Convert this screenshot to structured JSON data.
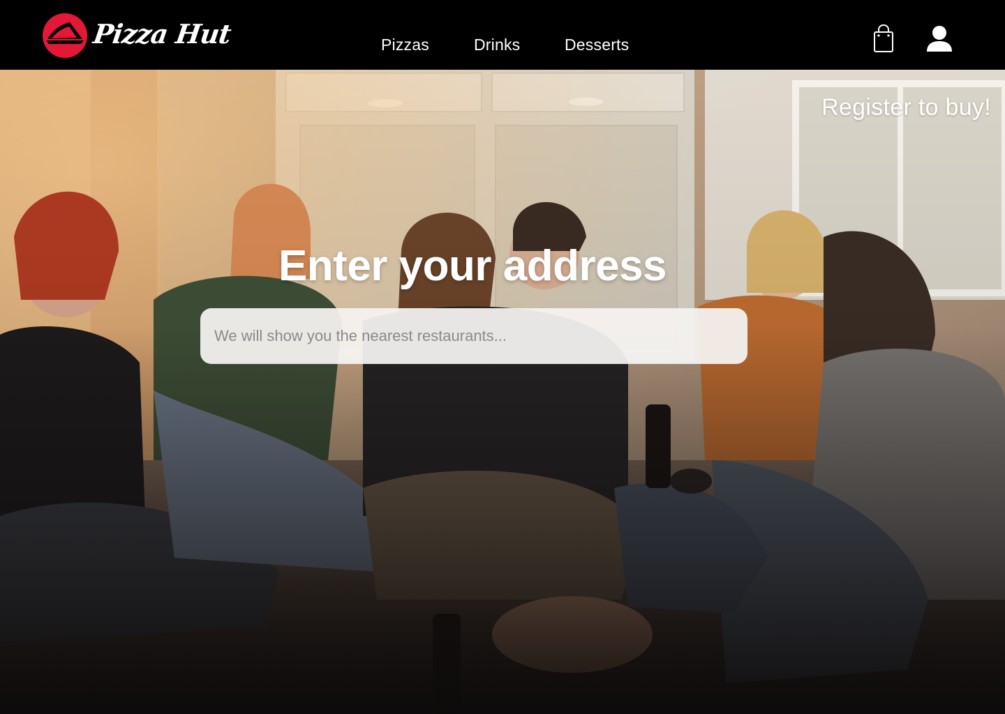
{
  "header": {
    "brand": "Pizza Hut",
    "nav": {
      "pizzas": "Pizzas",
      "drinks": "Drinks",
      "desserts": "Desserts"
    },
    "icons": {
      "cart": "shopping-bag-icon",
      "account": "user-icon"
    }
  },
  "hero": {
    "register_link": "Register to buy!",
    "title": "Enter your address",
    "search": {
      "placeholder": "We will show you the nearest restaurants...",
      "value": ""
    }
  },
  "colors": {
    "header_bg": "#000000",
    "brand_red": "#e31837",
    "text": "#ffffff",
    "input_bg": "#f4f2f0",
    "placeholder": "#8a8a8a"
  }
}
